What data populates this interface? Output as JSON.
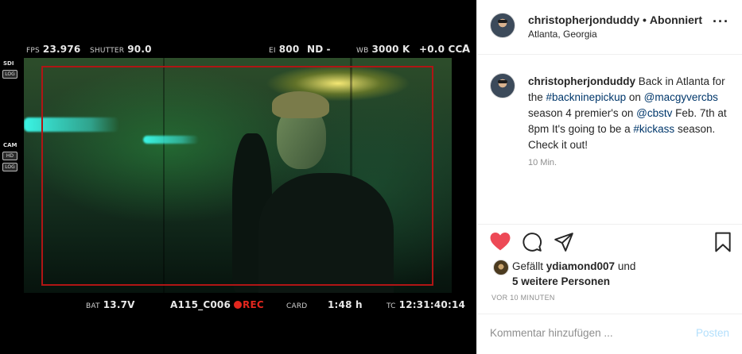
{
  "media": {
    "hud_top": {
      "fps_label": "FPS",
      "fps_value": "23.976",
      "shutter_label": "SHUTTER",
      "shutter_value": "90.0",
      "ei_label": "EI",
      "ei_value": "800",
      "nd_label": "ND",
      "nd_value": "-",
      "wb_label": "WB",
      "wb_value": "3000 K",
      "cc_value": "+0.0 CC",
      "channel": "A"
    },
    "side": {
      "sdi_label": "SDI",
      "sdi_box": "LOG",
      "cam_label": "CAM",
      "cam_hd": "HD",
      "cam_log": "LOG"
    },
    "hud_bottom": {
      "bat_label": "BAT",
      "bat_value": "13.7V",
      "clip": "A115_C006",
      "rec": "REC",
      "card_label": "CARD",
      "card_value": "1:48 h",
      "tc_label": "TC",
      "tc_value": "12:31:40:14"
    }
  },
  "post": {
    "username": "christopherjonduddy",
    "separator": "•",
    "follow_status": "Abonniert",
    "location": "Atlanta, Georgia",
    "more_icon": "more-horizontal-icon",
    "caption": {
      "username": "christopherjonduddy",
      "part1": " Back in Atlanta for the ",
      "tag1": "#backninepickup",
      "part2": " on ",
      "mention1": "@macgyvercbs",
      "part3": " season 4 premier's on ",
      "mention2": "@cbstv",
      "part4": " Feb. 7th at 8pm It's going to be a ",
      "tag2": "#kickass",
      "part5": " season. Check it out!"
    },
    "caption_time": "10 Min.",
    "actions": {
      "like_icon": "heart-filled-icon",
      "comment_icon": "comment-icon",
      "share_icon": "send-icon",
      "save_icon": "bookmark-icon",
      "like_color": "#ed4956"
    },
    "likes": {
      "prefix": "Gefällt ",
      "user": "ydiamond007",
      "middle": " und",
      "rest": "5 weitere Personen"
    },
    "date": "VOR 10 MINUTEN",
    "comment": {
      "placeholder": "Kommentar hinzufügen ...",
      "post_label": "Posten"
    }
  }
}
